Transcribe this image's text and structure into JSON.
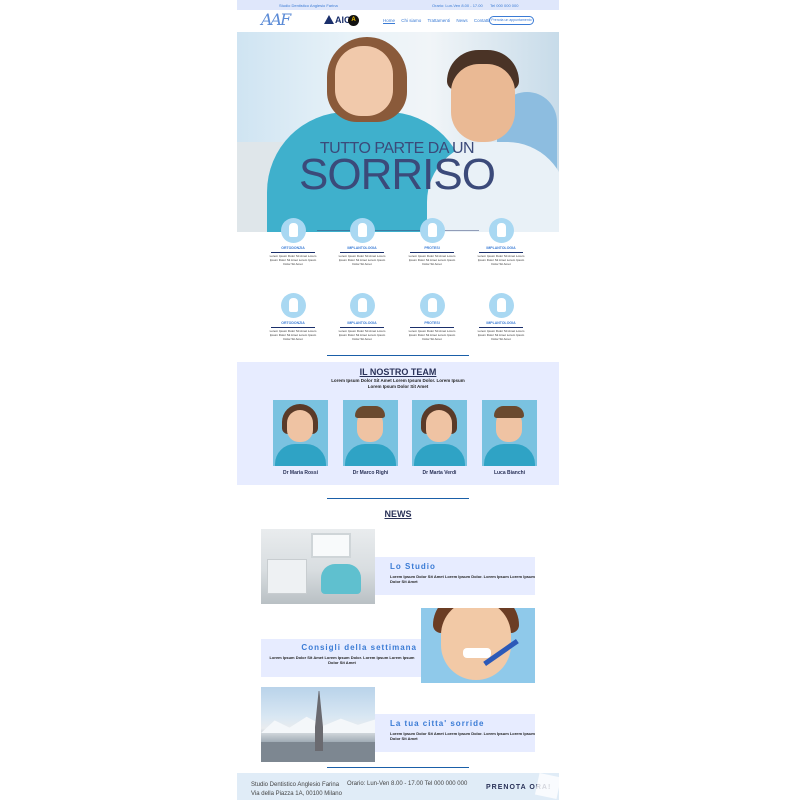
{
  "topbar": {
    "studio": "Studio Dentistico Anglesio Farina",
    "hours": "Orario: Lun-Ven 8.00 - 17.00",
    "phone": "Tel 000 000 000"
  },
  "nav": {
    "logo_text": "AAF",
    "partner_logo": "AIC",
    "partner_badge": "A",
    "menu": [
      "Home",
      "Chi siamo",
      "Trattamenti",
      "News",
      "Contatti"
    ],
    "cta": "Prenota un appuntamento"
  },
  "hero": {
    "line1": "TUTTO PARTE DA UN",
    "line2": "SORRISO"
  },
  "services": [
    {
      "title": "ORTODONZIA",
      "desc": "Lorem Ipsum Dolor Sit Amet Lorem Ipsum Dolor Sit Amet Lorem Ipsum Dolor Sit Amet"
    },
    {
      "title": "IMPLANTOLOGIA",
      "desc": "Lorem Ipsum Dolor Sit Amet Lorem Ipsum Dolor Sit Amet Lorem Ipsum Dolor Sit Amet"
    },
    {
      "title": "PROTESI",
      "desc": "Lorem Ipsum Dolor Sit Amet Lorem Ipsum Dolor Sit Amet Lorem Ipsum Dolor Sit Amet"
    },
    {
      "title": "IMPLANTOLOGIA",
      "desc": "Lorem Ipsum Dolor Sit Amet Lorem Ipsum Dolor Sit Amet Lorem Ipsum Dolor Sit Amet"
    },
    {
      "title": "ORTODONZIA",
      "desc": "Lorem Ipsum Dolor Sit Amet Lorem Ipsum Dolor Sit Amet Lorem Ipsum Dolor Sit Amet"
    },
    {
      "title": "IMPLANTOLOGIA",
      "desc": "Lorem Ipsum Dolor Sit Amet Lorem Ipsum Dolor Sit Amet Lorem Ipsum Dolor Sit Amet"
    },
    {
      "title": "PROTESI",
      "desc": "Lorem Ipsum Dolor Sit Amet Lorem Ipsum Dolor Sit Amet Lorem Ipsum Dolor Sit Amet"
    },
    {
      "title": "IMPLANTOLOGIA",
      "desc": "Lorem Ipsum Dolor Sit Amet Lorem Ipsum Dolor Sit Amet Lorem Ipsum Dolor Sit Amet"
    }
  ],
  "team": {
    "title": "IL NOSTRO TEAM",
    "subtitle": "Lorem Ipsum Dolor Sit Amet Lorem Ipsum Dolor. Lorem Ipsum Lorem Ipsum Dolor Sit Amet",
    "members": [
      "Dr Maria Rossi",
      "Dr Marco Righi",
      "Dr Marta Verdi",
      "Luca Bianchi"
    ]
  },
  "news": {
    "title": "NEWS",
    "items": [
      {
        "title": "Lo Studio",
        "desc": "Lorem Ipsum Dolor Sit Amet Lorem Ipsum Dolor. Lorem Ipsum Lorem Ipsum Dolor Sit Amet"
      },
      {
        "title": "Consigli della settimana",
        "desc": "Lorem Ipsum Dolor Sit Amet Lorem Ipsum Dolor. Lorem Ipsum Lorem Ipsum Dolor Sit Amet"
      },
      {
        "title": "La tua citta' sorride",
        "desc": "Lorem Ipsum Dolor Sit Amet Lorem Ipsum Dolor. Lorem Ipsum Lorem Ipsum Dolor Sit Amet"
      }
    ]
  },
  "footer": {
    "studio": "Studio Dentistico Anglesio Farina",
    "address": "Via della Piazza 1A, 00100 Milano",
    "hours": "Orario: Lun-Ven 8.00 - 17.00   Tel 000 000 000",
    "cta": "PRENOTA ORA!"
  },
  "colors": {
    "accent": "#3a7bd5",
    "navy": "#2a3258",
    "panel": "#e7ecff",
    "icon_bg": "#a9d8f2"
  }
}
